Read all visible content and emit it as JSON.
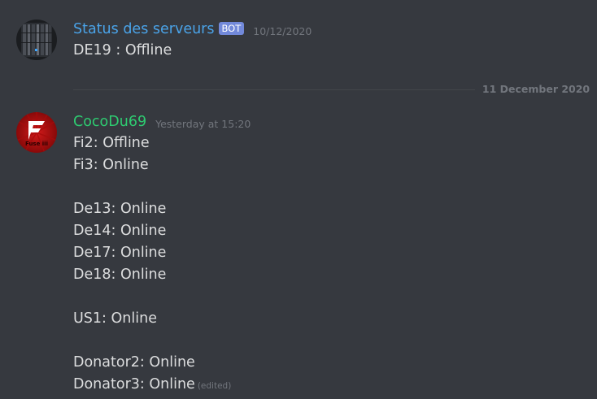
{
  "messages": [
    {
      "author": "Status des serveurs",
      "author_color": "#4aa3e8",
      "bot_tag": "BOT",
      "timestamp": "10/12/2020",
      "lines": [
        "DE19 : Offline"
      ]
    },
    {
      "author": "CocoDu69",
      "author_color": "#2ecc71",
      "timestamp": "Yesterday at 15:20",
      "lines": [
        "Fi2: Offline",
        "Fi3: Online",
        "",
        "De13: Online",
        "De14: Online",
        "De17: Online",
        "De18: Online",
        "",
        "US1: Online",
        "",
        "Donator2: Online",
        "Donator3: Online"
      ],
      "edited_label": "(edited)",
      "avatar_text": "Fuse iii"
    }
  ],
  "divider": {
    "label": "11 December 2020"
  },
  "colors": {
    "background": "#36393f",
    "text": "#dcddde",
    "muted": "#72767d",
    "bot_tag_bg": "#7289da"
  }
}
